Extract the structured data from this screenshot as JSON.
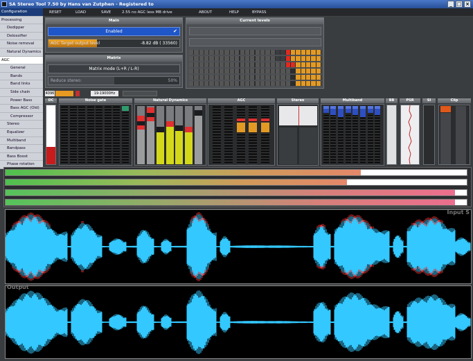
{
  "window": {
    "title": "SA Stereo Tool 7.50 by Hans van Zutphen - Registered to",
    "controls": [
      "_",
      "□",
      "×"
    ]
  },
  "menu": {
    "reset": "RESET",
    "load": "LOAD",
    "save": "SAVE",
    "preset": "2.55 no AGC less MB drive",
    "about": "ABOUT",
    "help": "HELP",
    "bypass": "BYPASS"
  },
  "sidebar": [
    {
      "label": "Configuration",
      "style": "hdr"
    },
    {
      "label": "Processing",
      "style": "top"
    },
    {
      "label": "Dedipper",
      "style": "sub"
    },
    {
      "label": "Delossifier",
      "style": "sub"
    },
    {
      "label": "Noise removal",
      "style": "sub"
    },
    {
      "label": "Natural Dynamics",
      "style": "sub"
    },
    {
      "label": "AGC",
      "style": "sel"
    },
    {
      "label": "General",
      "style": "sub2"
    },
    {
      "label": "Bands",
      "style": "sub2"
    },
    {
      "label": "Band links",
      "style": "sub2"
    },
    {
      "label": "Side chain",
      "style": "sub2"
    },
    {
      "label": "Power Bass",
      "style": "sub2"
    },
    {
      "label": "Bass AGC (Old)",
      "style": "sub2"
    },
    {
      "label": "Compressor",
      "style": "sub2"
    },
    {
      "label": "Stereo",
      "style": "sub"
    },
    {
      "label": "Equalizer",
      "style": "sub"
    },
    {
      "label": "Multiband",
      "style": "sub"
    },
    {
      "label": "Bandpass",
      "style": "sub"
    },
    {
      "label": "Bass Boost",
      "style": "sub"
    },
    {
      "label": "Phase rotation",
      "style": "sub"
    }
  ],
  "main": {
    "header": "Main",
    "enabled_label": "Enabled",
    "check": "✔",
    "agc_label": "AGC Target output level",
    "agc_value": "-8.82 dB ( 33560)",
    "agc_fill": 0.37
  },
  "matrix": {
    "header": "Matrix",
    "mode_label": "Matrix mode (L+R / L-R)",
    "reduce_label": "Reduce stereo:",
    "reduce_value": "50%",
    "reduce_fill": 0.5
  },
  "current_levels": {
    "header": "Current levels"
  },
  "bottom_row": {
    "rate": "4096",
    "freq": "19-19000Hz"
  },
  "meters": {
    "dc": "DC",
    "noise_gate": "Noise gate",
    "natural_dynamics": "Natural Dynamics",
    "agc": "AGC",
    "stereo": "Stereo",
    "multiband": "Multiband",
    "bb": "BB",
    "psr": "PSR",
    "si": "SI",
    "clip": "Clip"
  },
  "level_bars": [
    {
      "fill": 0.77,
      "color": "green-orange"
    },
    {
      "fill": 0.74,
      "color": "green-orange"
    },
    {
      "fill": 0.975,
      "color": "green-pink"
    },
    {
      "fill": 0.975,
      "color": "green-pink"
    }
  ],
  "waveforms": {
    "input_label": "Input S",
    "output_label": "Output",
    "accent": "#33c8ff",
    "clip": "#e03030"
  }
}
